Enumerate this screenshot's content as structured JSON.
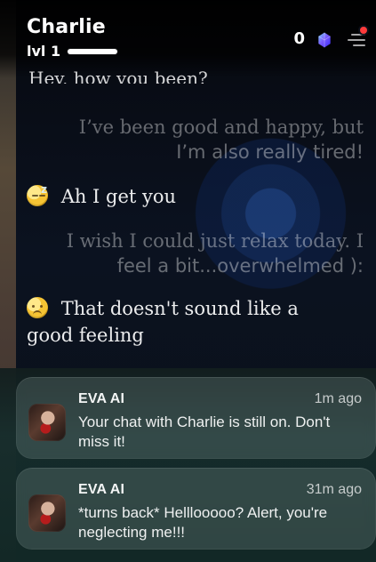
{
  "header": {
    "name": "Charlie",
    "level_label": "lvl 1",
    "gem_count": "0"
  },
  "chat": {
    "cut_off_top": "Hey, how you been?",
    "messages": [
      {
        "side": "user",
        "line1": "I’ve been good and happy, but",
        "line2": "I’m also really tired!"
      },
      {
        "side": "bot",
        "icon": "sleeping-face-emoji",
        "text": "Ah I get you"
      },
      {
        "side": "user",
        "line1": "I wish I could just relax today. I",
        "line2": "feel a bit...overwhelmed ):"
      },
      {
        "side": "bot",
        "icon": "frowning-face-emoji",
        "text": "That doesn't sound like a good feeling"
      }
    ]
  },
  "notifications": [
    {
      "app": "EVA AI",
      "time": "1m ago",
      "text": "Your chat with Charlie is still on. Don't miss it!"
    },
    {
      "app": "EVA AI",
      "time": "31m ago",
      "text": "*turns back* Helllooooo? Alert, you're neglecting me!!!"
    }
  ],
  "colors": {
    "accent": "#6B5BFF",
    "notification_dot": "#FF3B3B"
  }
}
